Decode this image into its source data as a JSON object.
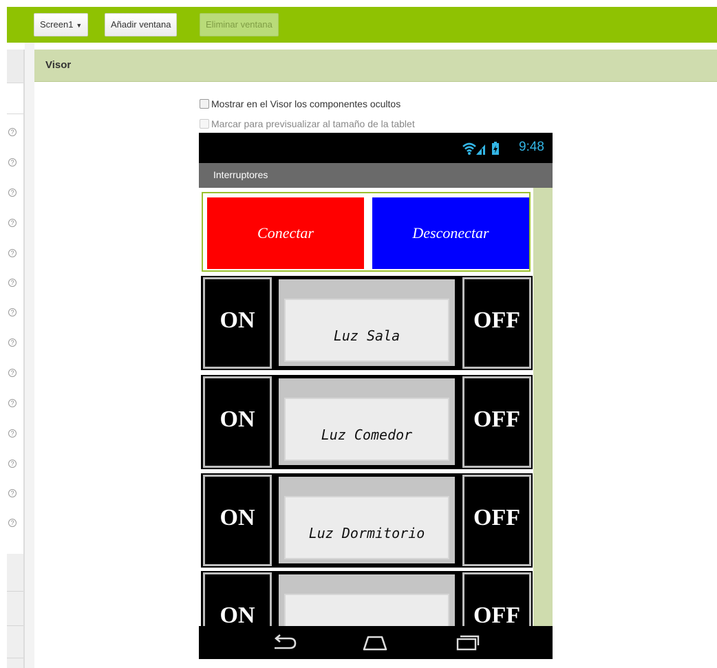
{
  "toolbar": {
    "screen_selector": "Screen1",
    "add_screen": "Añadir ventana",
    "remove_screen": "Eliminar ventana"
  },
  "viewer": {
    "title": "Visor",
    "show_hidden": "Mostrar en el Visor los componentes ocultos",
    "tablet_preview": "Marcar para previsualizar al tamaño de la tablet"
  },
  "help_icon_glyph": "?",
  "phone": {
    "time": "9:48",
    "app_title": "Interruptores",
    "connect": "Conectar",
    "disconnect": "Desconectar",
    "connect_color": "#ff0000",
    "disconnect_color": "#0000ff",
    "rows": [
      {
        "on": "ON",
        "off": "OFF",
        "label": "Luz Sala"
      },
      {
        "on": "ON",
        "off": "OFF",
        "label": "Luz Comedor"
      },
      {
        "on": "ON",
        "off": "OFF",
        "label": "Luz Dormitorio"
      },
      {
        "on": "ON",
        "off": "OFF",
        "label": ""
      }
    ]
  },
  "colors": {
    "toolbar_green": "#8fc202",
    "viewer_header": "#cfdcae",
    "status_blue": "#33b5e5"
  }
}
